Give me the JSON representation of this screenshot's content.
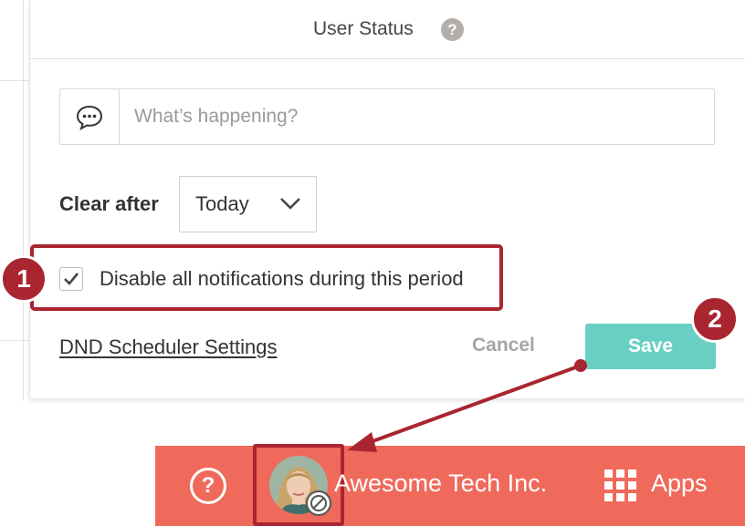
{
  "panel": {
    "title": "User Status",
    "help_glyph": "?"
  },
  "status_input": {
    "icon": "speech-bubble-icon",
    "placeholder": "What’s happening?"
  },
  "clear_after": {
    "label": "Clear after",
    "value": "Today"
  },
  "notifications": {
    "label": "Disable all notifications during this period",
    "checked": true
  },
  "actions": {
    "dnd_link": "DND Scheduler Settings",
    "cancel": "Cancel",
    "save": "Save"
  },
  "callouts": {
    "step1": "1",
    "step2": "2",
    "color": "#a92530"
  },
  "bottom_bar": {
    "help_glyph": "?",
    "company": "Awesome Tech Inc.",
    "apps_label": "Apps",
    "background": "#ef6a5b"
  },
  "colors": {
    "save_button": "#67d0c3",
    "accent_red": "#a92530"
  }
}
